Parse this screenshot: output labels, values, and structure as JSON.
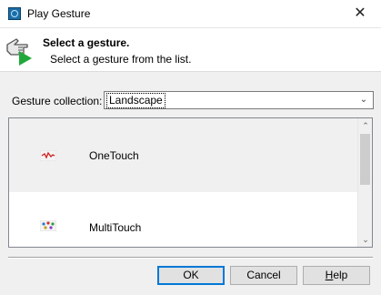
{
  "window": {
    "title": "Play Gesture",
    "close_glyph": "✕"
  },
  "header": {
    "title": "Select a gesture.",
    "subtitle": "Select a gesture from the list.",
    "icon": "hand-play-gesture-icon"
  },
  "collection": {
    "label": "Gesture collection:",
    "selected": "Landscape",
    "arrow_glyph": "⌄"
  },
  "gestures": [
    {
      "label": "OneTouch",
      "icon": "onetouch-thumbnail",
      "selected": true
    },
    {
      "label": "MultiTouch",
      "icon": "multitouch-thumbnail",
      "selected": false
    }
  ],
  "scroll": {
    "up_glyph": "⌃",
    "down_glyph": "⌄"
  },
  "buttons": {
    "ok": "OK",
    "cancel": "Cancel",
    "help_mnemonic": "H",
    "help_rest": "elp"
  },
  "colors": {
    "accent": "#0078d7",
    "play_arrow": "#21a83a",
    "selection_row": "#f0f0f0"
  }
}
